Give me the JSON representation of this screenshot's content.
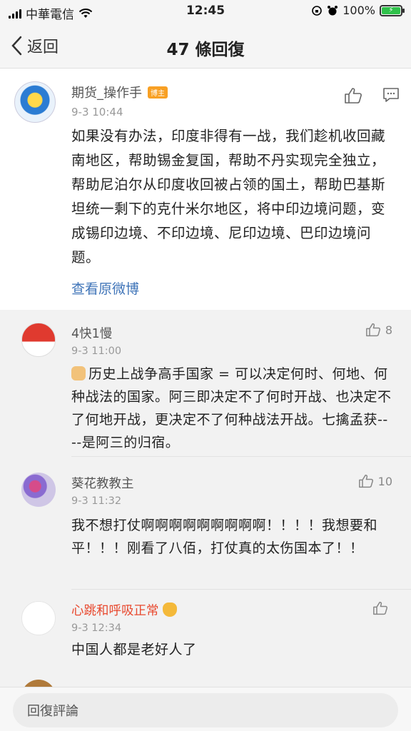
{
  "status_bar": {
    "carrier": "中華電信",
    "time": "12:45",
    "battery": "100%"
  },
  "nav": {
    "back_label": "返回",
    "title": "47 條回復"
  },
  "post": {
    "author": "期货_操作手",
    "author_badge": "博主",
    "time": "9-3 10:44",
    "content": "如果没有办法，印度非得有一战，我们趁机收回藏南地区，帮助锡金复国，帮助不丹实现完全独立，帮助尼泊尔从印度收回被占领的国土，帮助巴基斯坦统一剩下的克什米尔地区，将中印边境问题，变成锡印边境、不印边境、尼印边境、巴印边境问题。",
    "view_original": "查看原微博"
  },
  "comments": [
    {
      "name": "4快1慢",
      "time": "9-3 11:00",
      "likes": "8",
      "text": "历史上战争高手国家 = 可以决定何时、何地、何种战法的国家。阿三即决定不了何时开战、也决定不了何地开战，更决定不了何种战法开战。七擒孟获----是阿三的归宿。"
    },
    {
      "name": "葵花教教主",
      "time": "9-3 11:32",
      "likes": "10",
      "text": "我不想打仗啊啊啊啊啊啊啊啊啊！！！！我想要和平！！！刚看了八佰，打仗真的太伤国本了！！"
    },
    {
      "name": "心跳和呼吸正常",
      "time": "9-3 12:34",
      "likes": "",
      "text": "中国人都是老好人了"
    }
  ],
  "bottom": {
    "reply_placeholder": "回復評論"
  },
  "colors": {
    "link": "#3f74b8",
    "highlight_name": "#e8492f",
    "badge": "#f8a024",
    "battery": "#2fc14a"
  }
}
